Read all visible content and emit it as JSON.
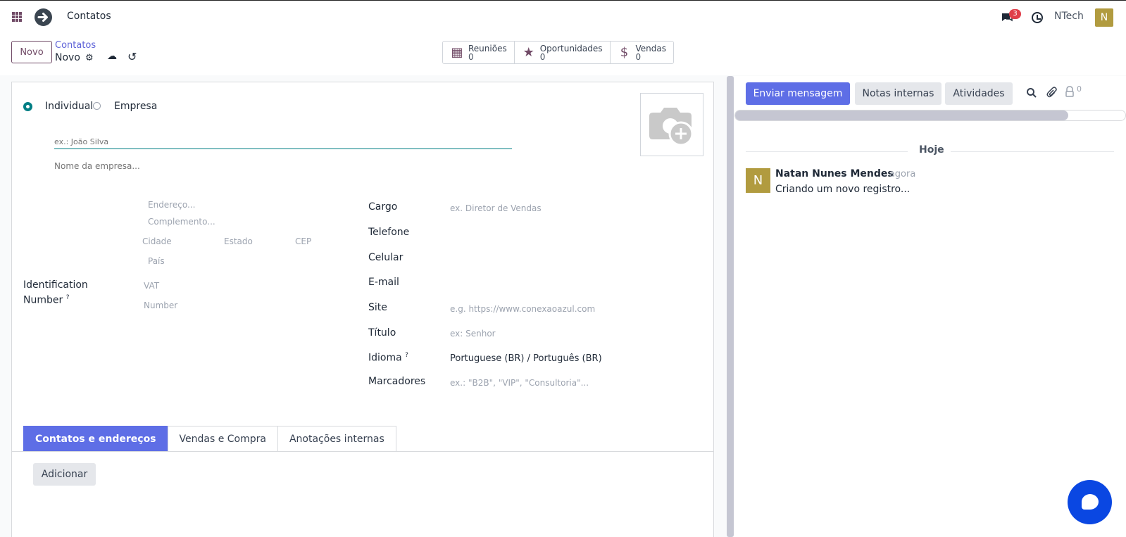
{
  "topbar": {
    "title": "Contatos",
    "chat_count": "3",
    "company": "NTech",
    "avatar_initial": "N"
  },
  "control": {
    "new_label": "Novo",
    "breadcrumb_parent": "Contatos",
    "breadcrumb_current": "Novo",
    "smart_buttons": [
      {
        "icon": "calendar-icon",
        "label": "Reuniões",
        "value": "0"
      },
      {
        "icon": "star-icon",
        "label": "Oportunidades",
        "value": "0"
      },
      {
        "icon": "dollar-icon",
        "label": "Vendas",
        "value": "0"
      }
    ]
  },
  "form": {
    "type_individual": "Individual",
    "type_company": "Empresa",
    "name_placeholder": "ex.: João Silva",
    "company_placeholder": "Nome da empresa...",
    "address": {
      "street": "Endereço...",
      "street2": "Complemento...",
      "city": "Cidade",
      "state": "Estado",
      "zip": "CEP",
      "country": "País"
    },
    "id_label_1": "Identification",
    "id_label_2": "Number",
    "id_help": "?",
    "vat_placeholder": "VAT",
    "number_placeholder": "Number",
    "fields": {
      "cargo_label": "Cargo",
      "cargo_placeholder": "ex. Diretor de Vendas",
      "telefone_label": "Telefone",
      "celular_label": "Celular",
      "email_label": "E-mail",
      "site_label": "Site",
      "site_placeholder": "e.g. https://www.conexaoazul.com",
      "titulo_label": "Título",
      "titulo_placeholder": "ex: Senhor",
      "idioma_label": "Idioma",
      "idioma_help": "?",
      "idioma_value": "Portuguese (BR) / Português (BR)",
      "marcadores_label": "Marcadores",
      "marcadores_placeholder": "ex.: \"B2B\", \"VIP\", \"Consultoria\"..."
    },
    "tabs": [
      "Contatos e endereços",
      "Vendas e Compra",
      "Anotações internas"
    ],
    "add_label": "Adicionar"
  },
  "chatter": {
    "send_label": "Enviar mensagem",
    "notes_label": "Notas internas",
    "activities_label": "Atividades",
    "followers_count": "0",
    "today_label": "Hoje",
    "message": {
      "avatar_initial": "N",
      "author": "Natan Nunes Mendes",
      "time": "- agora",
      "body": "Criando um novo registro..."
    }
  }
}
